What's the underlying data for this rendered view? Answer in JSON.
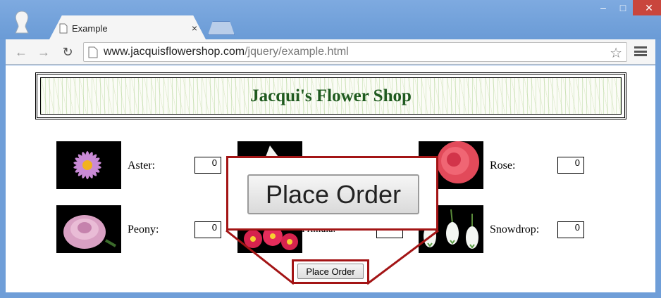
{
  "browser": {
    "tab_title": "Example",
    "tab_close": "×",
    "url_host": "www.jacquisflowershop.com",
    "url_path": "/jquery/example.html",
    "minimize": "–",
    "maximize": "□",
    "close": "✕"
  },
  "page": {
    "title": "Jacqui's Flower Shop",
    "flowers": [
      {
        "label": "Aster:",
        "quantity": "0"
      },
      {
        "label": "Peony:",
        "quantity": "0"
      },
      {
        "label": "Primula:",
        "quantity": "0"
      },
      {
        "label": "Rose:",
        "quantity": "0"
      },
      {
        "label": "Snowdrop:",
        "quantity": "0"
      }
    ],
    "order_button": "Place Order",
    "zoom_button": "Place Order"
  },
  "colors": {
    "title_green": "#1f5a1f",
    "callout_red": "#a31415",
    "chrome_blue": "#6f9ed8"
  }
}
